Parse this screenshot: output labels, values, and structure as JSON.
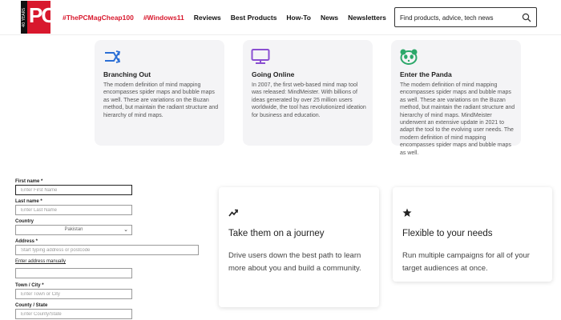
{
  "header": {
    "logo_side_text": "40 YEARS",
    "logo_text": "PC",
    "nav": [
      {
        "label": "#ThePCMagCheap100",
        "accent": true
      },
      {
        "label": "#Windows11",
        "accent": true
      },
      {
        "label": "Reviews",
        "accent": false
      },
      {
        "label": "Best Products",
        "accent": false
      },
      {
        "label": "How-To",
        "accent": false
      },
      {
        "label": "News",
        "accent": false
      },
      {
        "label": "Newsletters",
        "accent": false
      }
    ],
    "search_placeholder": "Find products, advice, tech news"
  },
  "features": [
    {
      "icon": "branch-arrows-icon",
      "title": "Branching Out",
      "text": "The modern definition of mind mapping encompasses spider maps and bubble maps as well. These are variations on the Buzan method, but maintain the radiant structure and hierarchy of mind maps."
    },
    {
      "icon": "monitor-icon",
      "title": "Going Online",
      "text": "In 2007, the first web-based mind map tool was released: MindMeister. With billions of ideas generated by over 25 million users worldwide, the tool has revolutionized ideation for business and education."
    },
    {
      "icon": "panda-icon",
      "title": "Enter the Panda",
      "text": "The modern definition of mind mapping encompasses spider maps and bubble maps as well. These are variations on the Buzan method, but maintain the radiant structure and hierarchy of mind maps. MindMeister underwent an extensive update in 2021 to adapt the tool to the evolving user needs. The modern definition of mind mapping encompasses spider maps and bubble maps as well."
    }
  ],
  "form": {
    "first_name_label": "First name *",
    "first_name_placeholder": "Enter First Name",
    "last_name_label": "Last name *",
    "last_name_placeholder": "Enter Last Name",
    "country_label": "Country",
    "country_value": "Pakistan",
    "address_label": "Address *",
    "address_placeholder": "Start typing address or postcode",
    "manual_link": "Enter address manually",
    "town_label": "Town / City *",
    "town_placeholder": "Enter Town or City",
    "county_label": "County / State",
    "county_placeholder": "Enter County/State"
  },
  "cards": [
    {
      "icon": "trend-arrow-icon",
      "title": "Take them on a journey",
      "text": "Drive users down the best path to learn more about you and build a community."
    },
    {
      "icon": "star-icon",
      "title": "Flexible to your needs",
      "text": "Run multiple campaigns for all of your target audiences at once."
    }
  ],
  "colors": {
    "brand_red": "#d8182d",
    "feature_icon_blue": "#2b6fd6",
    "feature_icon_purple": "#8a4fd1",
    "feature_icon_green": "#2ca86a"
  }
}
